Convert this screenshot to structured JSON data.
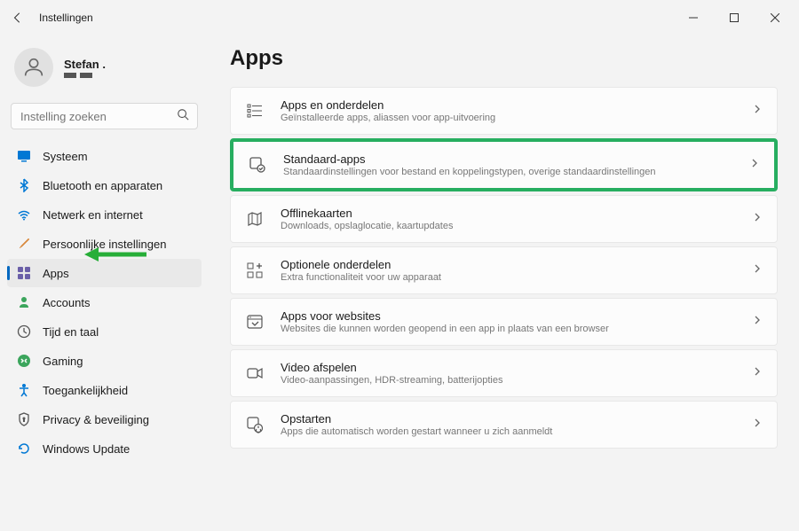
{
  "window": {
    "title": "Instellingen"
  },
  "profile": {
    "name": "Stefan ."
  },
  "search": {
    "placeholder": "Instelling zoeken"
  },
  "sidebar": {
    "items": [
      {
        "label": "Systeem",
        "icon": "system"
      },
      {
        "label": "Bluetooth en apparaten",
        "icon": "bluetooth"
      },
      {
        "label": "Netwerk en internet",
        "icon": "network"
      },
      {
        "label": "Persoonlijke instellingen",
        "icon": "personalize"
      },
      {
        "label": "Apps",
        "icon": "apps",
        "active": true
      },
      {
        "label": "Accounts",
        "icon": "accounts"
      },
      {
        "label": "Tijd en taal",
        "icon": "time"
      },
      {
        "label": "Gaming",
        "icon": "gaming"
      },
      {
        "label": "Toegankelijkheid",
        "icon": "accessibility"
      },
      {
        "label": "Privacy & beveiliging",
        "icon": "privacy"
      },
      {
        "label": "Windows Update",
        "icon": "update"
      }
    ]
  },
  "page": {
    "title": "Apps"
  },
  "cards": [
    {
      "title": "Apps en onderdelen",
      "desc": "Geïnstalleerde apps, aliassen voor app-uitvoering"
    },
    {
      "title": "Standaard-apps",
      "desc": "Standaardinstellingen voor bestand en koppelingstypen, overige standaardinstellingen",
      "highlighted": true
    },
    {
      "title": "Offlinekaarten",
      "desc": "Downloads, opslaglocatie, kaartupdates"
    },
    {
      "title": "Optionele onderdelen",
      "desc": "Extra functionaliteit voor uw apparaat"
    },
    {
      "title": "Apps voor websites",
      "desc": "Websites die kunnen worden geopend in een app in plaats van een browser"
    },
    {
      "title": "Video afspelen",
      "desc": "Video-aanpassingen, HDR-streaming, batterijopties"
    },
    {
      "title": "Opstarten",
      "desc": "Apps die automatisch worden gestart wanneer u zich aanmeldt"
    }
  ]
}
